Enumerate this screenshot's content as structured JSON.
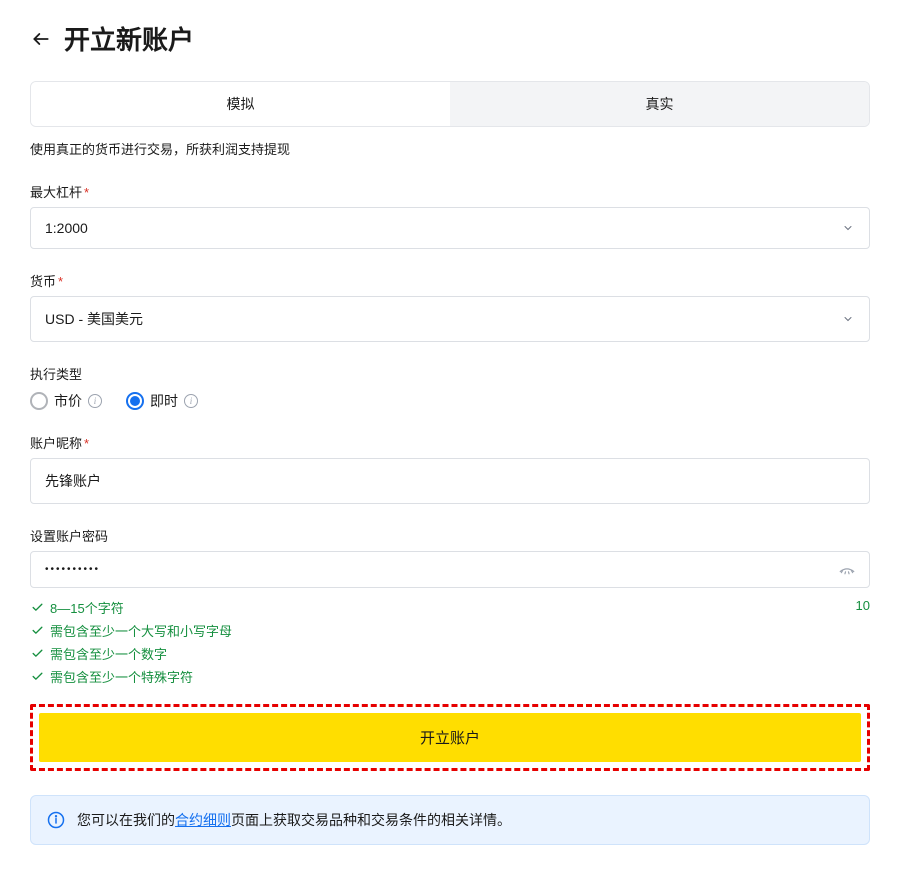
{
  "header": {
    "title": "开立新账户"
  },
  "tabs": {
    "demo": "模拟",
    "real": "真实"
  },
  "subtext": "使用真正的货币进行交易，所获利润支持提现",
  "leverage": {
    "label": "最大杠杆",
    "value": "1:2000"
  },
  "currency": {
    "label": "货币",
    "value": "USD - 美国美元"
  },
  "execution": {
    "label": "执行类型",
    "market": "市价",
    "instant": "即时"
  },
  "nickname": {
    "label": "账户昵称",
    "value": "先锋账户"
  },
  "password": {
    "label": "设置账户密码",
    "masked": "••••••••••",
    "count": "10",
    "rules": {
      "r1": "8—15个字符",
      "r2": "需包含至少一个大写和小写字母",
      "r3": "需包含至少一个数字",
      "r4": "需包含至少一个特殊字符"
    }
  },
  "submit": "开立账户",
  "notice": {
    "prefix": "您可以在我们的",
    "link": "合约细则",
    "suffix": "页面上获取交易品种和交易条件的相关详情。"
  }
}
